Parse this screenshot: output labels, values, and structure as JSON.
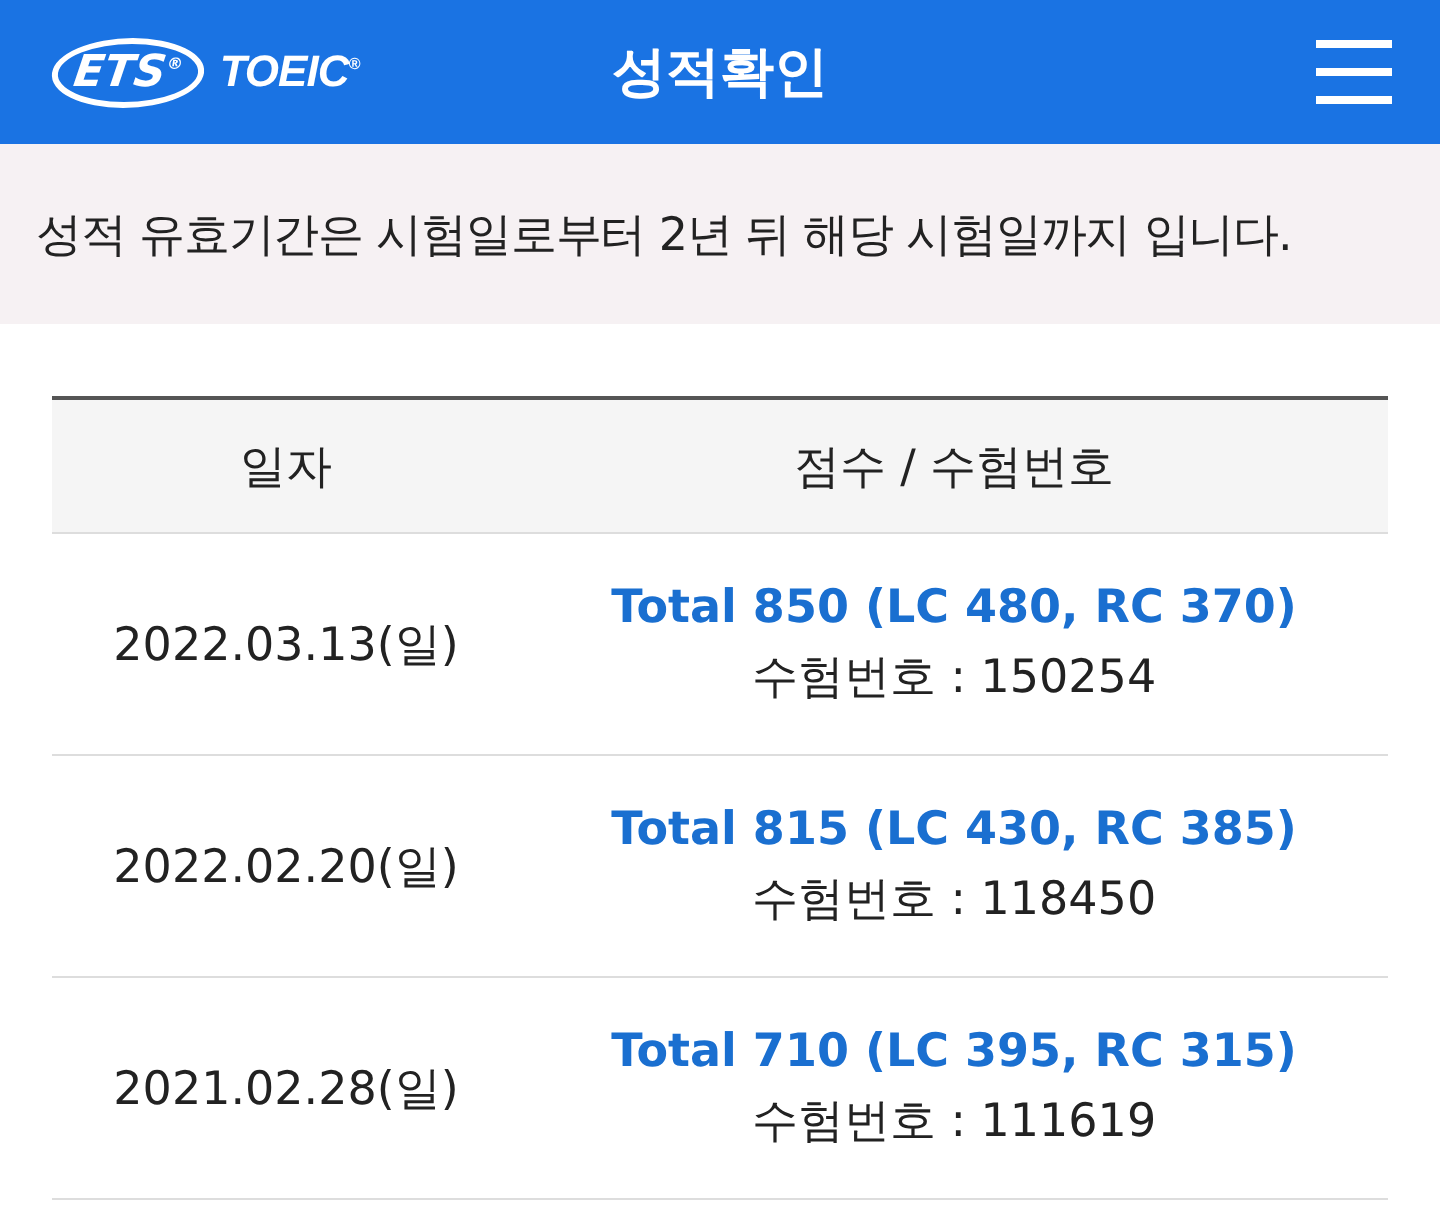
{
  "header": {
    "logo_parts": [
      "ETS$^{®}$",
      "TOEIC$^{®}$"
    ],
    "title": "성적확인"
  },
  "notice": "성적 유효기간은 시험일로부터 2년 뒤 해당 시험일까지 입니다.",
  "table": {
    "columns": [
      "일자",
      "점수 / 수험번호"
    ],
    "rows": [
      {
        "date": "2022.03.13(일)",
        "total": "Total 850 (LC 480, RC 370)",
        "exam_number": "수험번호 : 150254"
      },
      {
        "date": "2022.02.20(일)",
        "total": "Total 815 (LC 430, RC 385)",
        "exam_number": "수험번호 : 118450"
      },
      {
        "date": "2021.02.28(일)",
        "total": "Total 710 (LC 395, RC 315)",
        "exam_number": "수험번호 : 111619"
      }
    ]
  }
}
